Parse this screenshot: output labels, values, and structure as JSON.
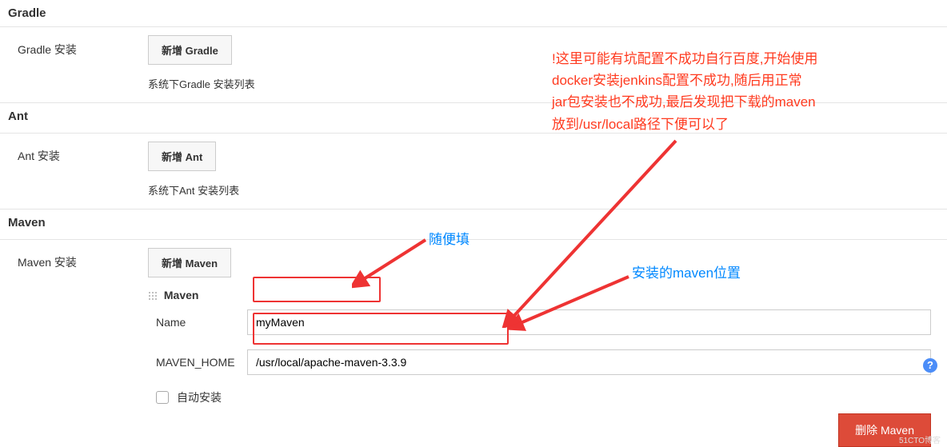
{
  "sections": {
    "gradle": {
      "title": "Gradle",
      "label": "Gradle 安装",
      "button": "新增 Gradle",
      "helper": "系统下Gradle 安装列表"
    },
    "ant": {
      "title": "Ant",
      "label": "Ant 安装",
      "button": "新增 Ant",
      "helper": "系统下Ant 安装列表"
    },
    "maven": {
      "title": "Maven",
      "label": "Maven 安装",
      "button": "新增 Maven",
      "installer_header": "Maven",
      "name_label": "Name",
      "name_value": "myMaven",
      "home_label": "MAVEN_HOME",
      "home_value": "/usr/local/apache-maven-3.3.9",
      "auto_install_label": "自动安装",
      "delete_button": "删除 Maven"
    }
  },
  "annotations": {
    "warning_line1": "!这里可能有坑配置不成功自行百度,开始使用",
    "warning_line2": "docker安装jenkins配置不成功,随后用正常",
    "warning_line3": "jar包安装也不成功,最后发现把下载的maven",
    "warning_line4": "放到/usr/local路径下便可以了",
    "name_hint": "随便填",
    "home_hint": "安装的maven位置"
  },
  "watermark": "51CTO博客"
}
